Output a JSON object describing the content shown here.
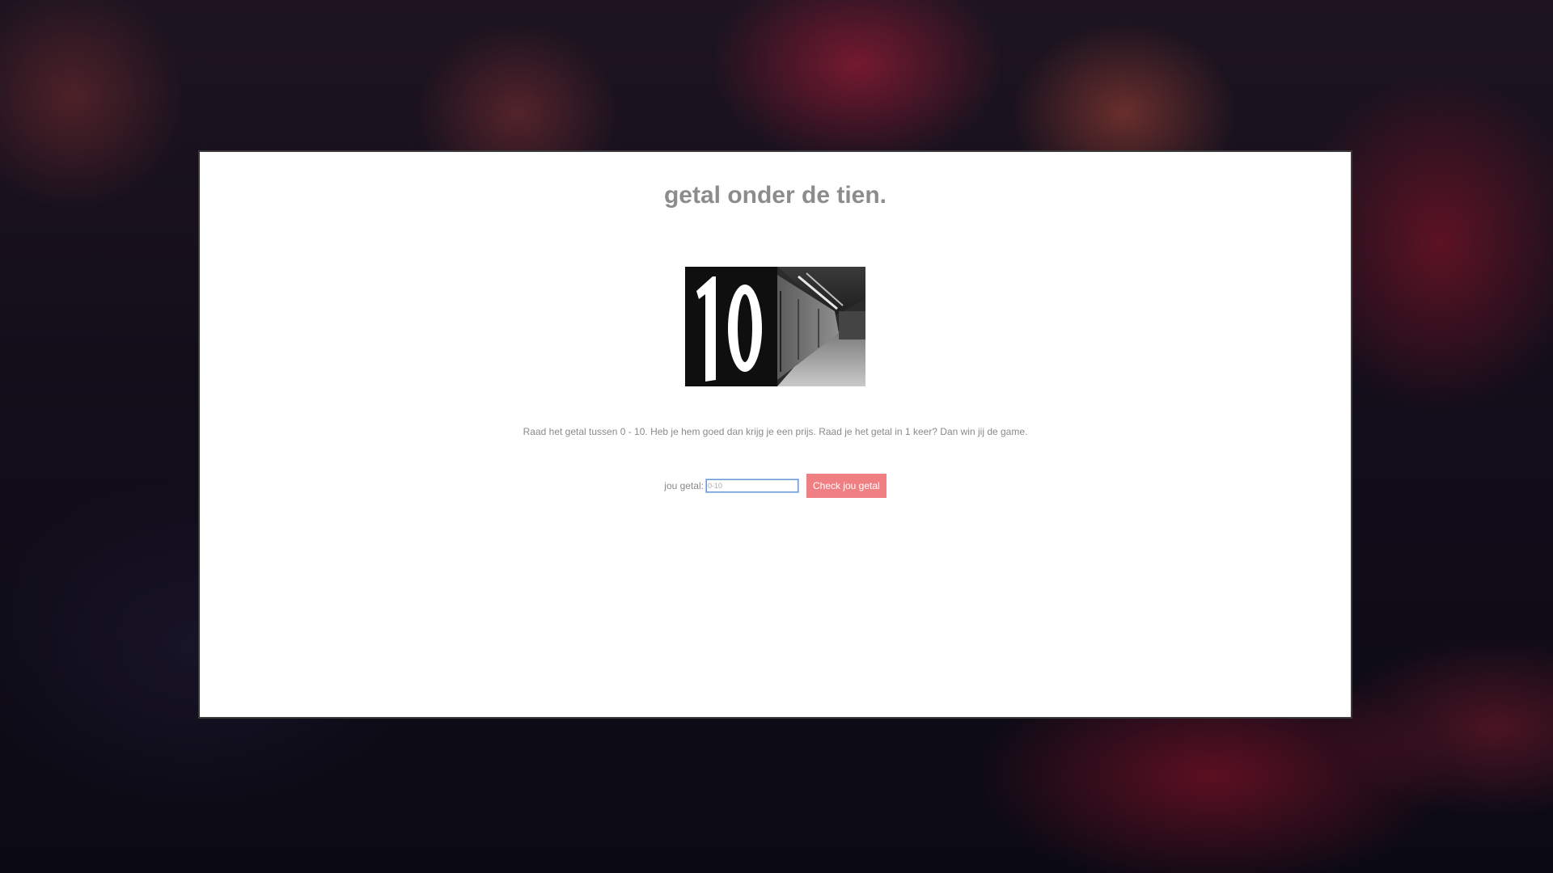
{
  "page": {
    "title": "getal onder de tien.",
    "image": {
      "alt": "10",
      "number": "10"
    },
    "description": "Raad het getal tussen 0 - 10. Heb je hem goed dan krijg je een prijs. Raad je het getal in 1 keer? Dan win jij de game.",
    "form": {
      "label": "jou getal:",
      "input_value": "",
      "input_placeholder": "0-10",
      "button_label": "Check jou getal"
    }
  },
  "colors": {
    "title": "#8c8c8c",
    "text": "#8a8a8a",
    "button": "#f07f83",
    "button_text": "#ffffff",
    "panel": "#ffffff"
  }
}
